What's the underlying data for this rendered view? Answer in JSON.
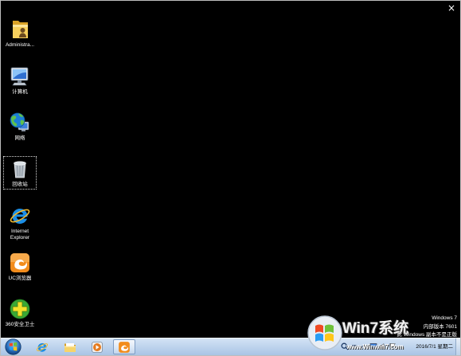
{
  "window": {
    "close_glyph": "×",
    "close_icon": "close-icon"
  },
  "desktop": {
    "icons": [
      {
        "label": "Administra...",
        "icon": "user-folder-icon",
        "selected": false
      },
      {
        "label": "计算机",
        "icon": "computer-icon",
        "selected": false
      },
      {
        "label": "网络",
        "icon": "network-icon",
        "selected": false
      },
      {
        "label": "回收站",
        "icon": "recycle-bin-icon",
        "selected": true
      },
      {
        "label": "Internet Explorer",
        "icon": "internet-explorer-icon",
        "selected": false
      },
      {
        "label": "UC浏览器",
        "icon": "uc-browser-icon",
        "selected": false
      },
      {
        "label": "360安全卫士",
        "icon": "360-safe-icon",
        "selected": false
      }
    ]
  },
  "activation_notice": {
    "os_name": "Windows 7",
    "build": "内部版本 7601",
    "warning": "此 Windows 副本不是正版"
  },
  "watermark": {
    "logo_icon": "windows-logo-icon",
    "brand": "Win7系统",
    "url": "www.Winwin7.com"
  },
  "taskbar": {
    "start_icon": "start-orb-icon",
    "pinned": [
      {
        "icon": "internet-explorer-icon",
        "active": false
      },
      {
        "icon": "windows-explorer-icon",
        "active": false
      },
      {
        "icon": "media-player-icon",
        "active": false
      },
      {
        "icon": "uc-browser-icon",
        "active": true
      }
    ],
    "tray_icons": [
      "search-icon",
      "arrow-icon",
      "show-hidden-icons-icon",
      "network-tray-icon",
      "volume-icon",
      "action-center-icon"
    ],
    "clock_date": "2016/7/1 星期二"
  },
  "colors": {
    "desktop_background": "#000000",
    "label_text": "#ffffff",
    "taskbar_top": "#d3e3f5",
    "taskbar_bottom": "#a9c4e5",
    "notice_text": "#ffffff"
  }
}
